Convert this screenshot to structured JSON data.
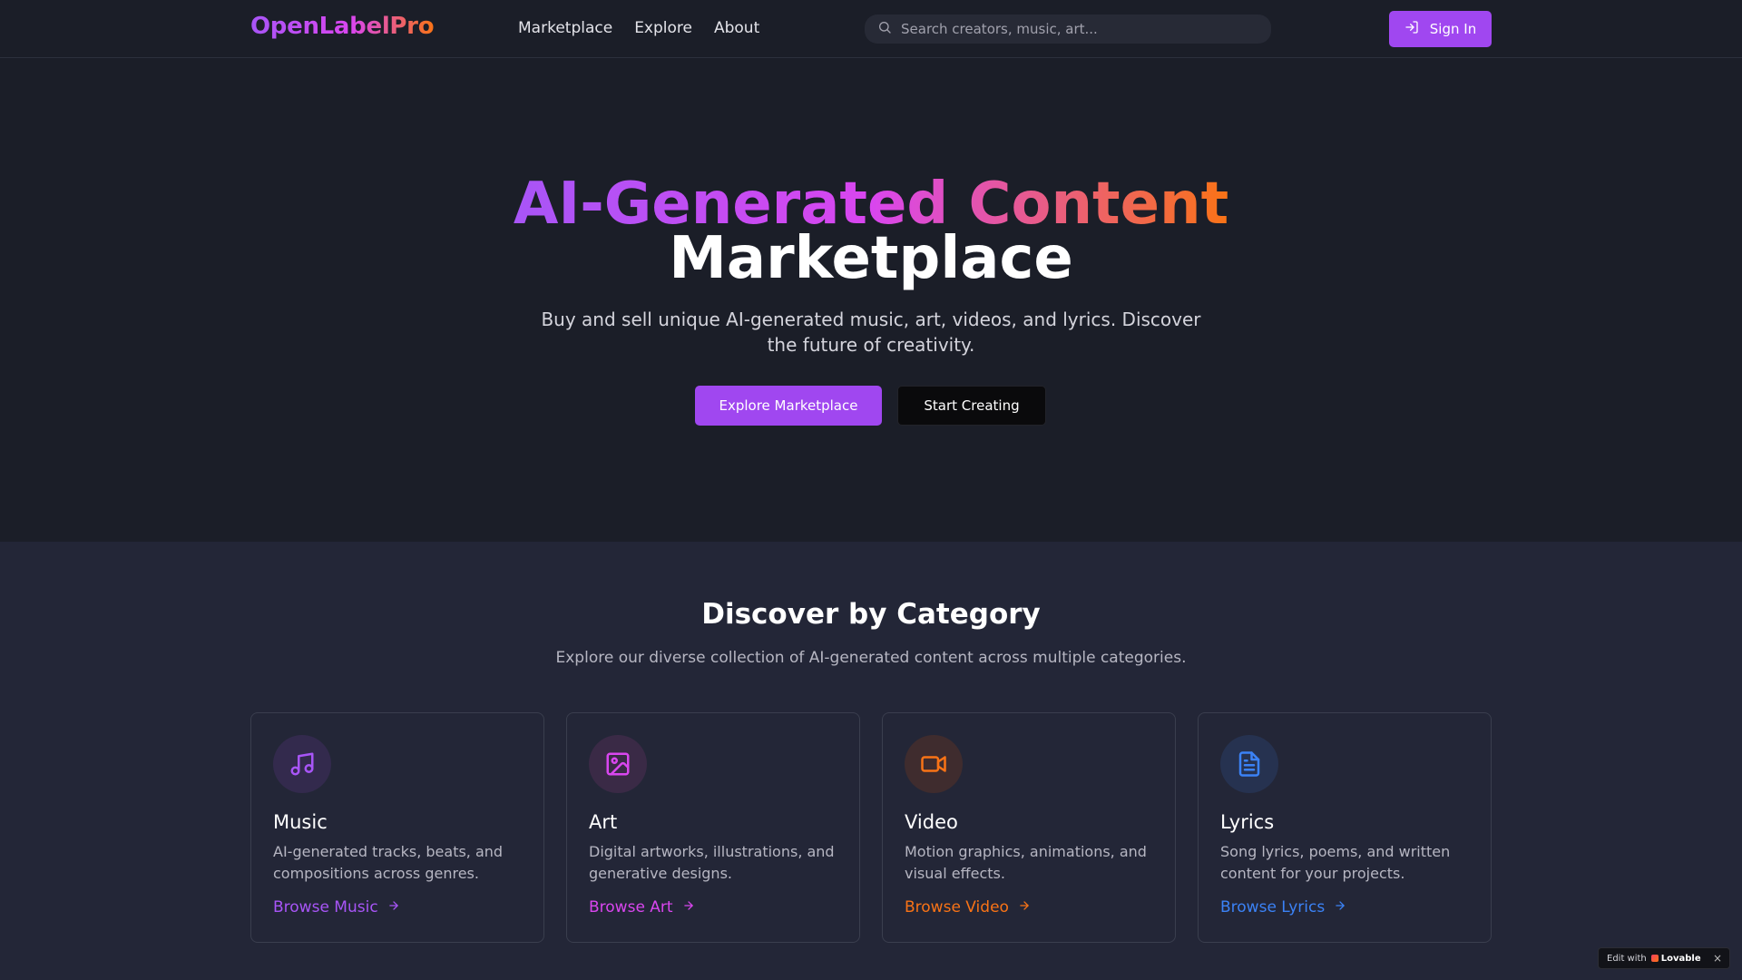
{
  "header": {
    "logo": "OpenLabelPro",
    "nav": [
      "Marketplace",
      "Explore",
      "About"
    ],
    "search_placeholder": "Search creators, music, art...",
    "signin_label": "Sign In"
  },
  "hero": {
    "title_gradient": "AI-Generated Content",
    "title_plain": "Marketplace",
    "subtitle": "Buy and sell unique AI-generated music, art, videos, and lyrics. Discover the future of creativity.",
    "primary_cta": "Explore Marketplace",
    "secondary_cta": "Start Creating"
  },
  "categories": {
    "title": "Discover by Category",
    "subtitle": "Explore our diverse collection of AI-generated content across multiple categories.",
    "items": [
      {
        "name": "Music",
        "icon": "music-note-icon",
        "description": "AI-generated tracks, beats, and compositions across genres.",
        "link": "Browse Music",
        "color": "#a855f7",
        "icon_bg": "#332a4d"
      },
      {
        "name": "Art",
        "icon": "image-icon",
        "description": "Digital artworks, illustrations, and generative designs.",
        "link": "Browse Art",
        "color": "#d946ef",
        "icon_bg": "#3a2a46"
      },
      {
        "name": "Video",
        "icon": "video-camera-icon",
        "description": "Motion graphics, animations, and visual effects.",
        "link": "Browse Video",
        "color": "#f97316",
        "icon_bg": "#3f2c2e"
      },
      {
        "name": "Lyrics",
        "icon": "document-icon",
        "description": "Song lyrics, poems, and written content for your projects.",
        "link": "Browse Lyrics",
        "color": "#3b82f6",
        "icon_bg": "#263250"
      }
    ]
  },
  "badge": {
    "prefix": "Edit with",
    "brand": "Lovable",
    "close": "×"
  }
}
